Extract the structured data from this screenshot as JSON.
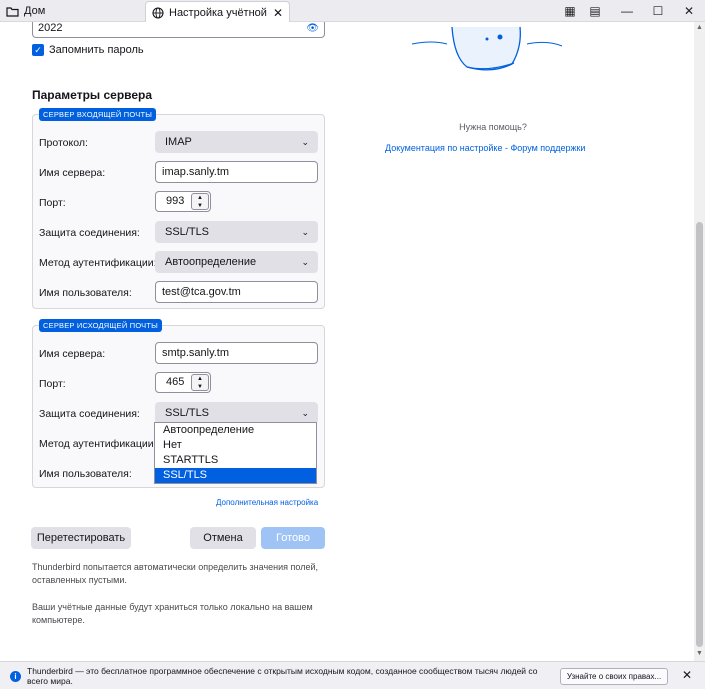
{
  "tabs": [
    {
      "label": "Дом",
      "icon": "folder-icon"
    },
    {
      "label": "Настройка учётной записи",
      "icon": "globe-icon"
    }
  ],
  "window": {
    "minimize": "—",
    "maximize": "☐",
    "close": "✕"
  },
  "account": {
    "password_value": "2022",
    "remember_label": "Запомнить пароль"
  },
  "server": {
    "title": "Параметры сервера",
    "incoming": {
      "legend": "СЕРВЕР ВХОДЯЩЕЙ ПОЧТЫ",
      "protocol_label": "Протокол:",
      "protocol_value": "IMAP",
      "hostname_label": "Имя сервера:",
      "hostname_value": "imap.sanly.tm",
      "port_label": "Порт:",
      "port_value": "993",
      "security_label": "Защита соединения:",
      "security_value": "SSL/TLS",
      "auth_label": "Метод аутентификации:",
      "auth_value": "Автоопределение",
      "username_label": "Имя пользователя:",
      "username_value": "test@tca.gov.tm"
    },
    "outgoing": {
      "legend": "СЕРВЕР ИСХОДЯЩЕЙ ПОЧТЫ",
      "hostname_label": "Имя сервера:",
      "hostname_value": "smtp.sanly.tm",
      "port_label": "Порт:",
      "port_value": "465",
      "security_label": "Защита соединения:",
      "security_value": "SSL/TLS",
      "auth_label": "Метод аутентификации:",
      "username_label": "Имя пользователя:"
    },
    "security_options": [
      "Автоопределение",
      "Нет",
      "STARTTLS",
      "SSL/TLS"
    ],
    "security_selected": "SSL/TLS",
    "advanced_link": "Дополнительная настройка"
  },
  "buttons": {
    "retest": "Перетестировать",
    "cancel": "Отмена",
    "done": "Готово"
  },
  "notes": {
    "autodetect": "Thunderbird попытается автоматически определить значения полей, оставленных пустыми.",
    "local_storage": "Ваши учётные данные будут храниться только локально на вашем компьютере."
  },
  "help": {
    "title": "Нужна помощь?",
    "links": "Документация по настройке - Форум поддержки"
  },
  "notification": {
    "text": "Thunderbird — это бесплатное программное обеспечение с открытым исходным кодом, созданное сообществом тысяч людей со всего мира.",
    "button": "Узнайте о своих правах...",
    "close": "✕"
  },
  "colors": {
    "accent": "#0060df",
    "disabled_button": "#9fc3f5"
  }
}
